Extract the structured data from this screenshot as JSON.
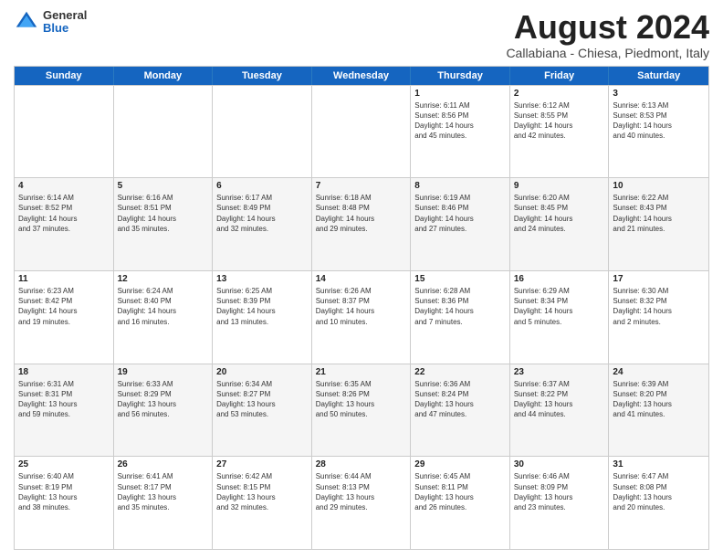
{
  "logo": {
    "general": "General",
    "blue": "Blue"
  },
  "header": {
    "month": "August 2024",
    "location": "Callabiana - Chiesa, Piedmont, Italy"
  },
  "days_of_week": [
    "Sunday",
    "Monday",
    "Tuesday",
    "Wednesday",
    "Thursday",
    "Friday",
    "Saturday"
  ],
  "weeks": [
    [
      {
        "day": "",
        "info": "",
        "empty": true
      },
      {
        "day": "",
        "info": "",
        "empty": true
      },
      {
        "day": "",
        "info": "",
        "empty": true
      },
      {
        "day": "",
        "info": "",
        "empty": true
      },
      {
        "day": "1",
        "info": "Sunrise: 6:11 AM\nSunset: 8:56 PM\nDaylight: 14 hours\nand 45 minutes."
      },
      {
        "day": "2",
        "info": "Sunrise: 6:12 AM\nSunset: 8:55 PM\nDaylight: 14 hours\nand 42 minutes."
      },
      {
        "day": "3",
        "info": "Sunrise: 6:13 AM\nSunset: 8:53 PM\nDaylight: 14 hours\nand 40 minutes."
      }
    ],
    [
      {
        "day": "4",
        "info": "Sunrise: 6:14 AM\nSunset: 8:52 PM\nDaylight: 14 hours\nand 37 minutes."
      },
      {
        "day": "5",
        "info": "Sunrise: 6:16 AM\nSunset: 8:51 PM\nDaylight: 14 hours\nand 35 minutes."
      },
      {
        "day": "6",
        "info": "Sunrise: 6:17 AM\nSunset: 8:49 PM\nDaylight: 14 hours\nand 32 minutes."
      },
      {
        "day": "7",
        "info": "Sunrise: 6:18 AM\nSunset: 8:48 PM\nDaylight: 14 hours\nand 29 minutes."
      },
      {
        "day": "8",
        "info": "Sunrise: 6:19 AM\nSunset: 8:46 PM\nDaylight: 14 hours\nand 27 minutes."
      },
      {
        "day": "9",
        "info": "Sunrise: 6:20 AM\nSunset: 8:45 PM\nDaylight: 14 hours\nand 24 minutes."
      },
      {
        "day": "10",
        "info": "Sunrise: 6:22 AM\nSunset: 8:43 PM\nDaylight: 14 hours\nand 21 minutes."
      }
    ],
    [
      {
        "day": "11",
        "info": "Sunrise: 6:23 AM\nSunset: 8:42 PM\nDaylight: 14 hours\nand 19 minutes."
      },
      {
        "day": "12",
        "info": "Sunrise: 6:24 AM\nSunset: 8:40 PM\nDaylight: 14 hours\nand 16 minutes."
      },
      {
        "day": "13",
        "info": "Sunrise: 6:25 AM\nSunset: 8:39 PM\nDaylight: 14 hours\nand 13 minutes."
      },
      {
        "day": "14",
        "info": "Sunrise: 6:26 AM\nSunset: 8:37 PM\nDaylight: 14 hours\nand 10 minutes."
      },
      {
        "day": "15",
        "info": "Sunrise: 6:28 AM\nSunset: 8:36 PM\nDaylight: 14 hours\nand 7 minutes."
      },
      {
        "day": "16",
        "info": "Sunrise: 6:29 AM\nSunset: 8:34 PM\nDaylight: 14 hours\nand 5 minutes."
      },
      {
        "day": "17",
        "info": "Sunrise: 6:30 AM\nSunset: 8:32 PM\nDaylight: 14 hours\nand 2 minutes."
      }
    ],
    [
      {
        "day": "18",
        "info": "Sunrise: 6:31 AM\nSunset: 8:31 PM\nDaylight: 13 hours\nand 59 minutes."
      },
      {
        "day": "19",
        "info": "Sunrise: 6:33 AM\nSunset: 8:29 PM\nDaylight: 13 hours\nand 56 minutes."
      },
      {
        "day": "20",
        "info": "Sunrise: 6:34 AM\nSunset: 8:27 PM\nDaylight: 13 hours\nand 53 minutes."
      },
      {
        "day": "21",
        "info": "Sunrise: 6:35 AM\nSunset: 8:26 PM\nDaylight: 13 hours\nand 50 minutes."
      },
      {
        "day": "22",
        "info": "Sunrise: 6:36 AM\nSunset: 8:24 PM\nDaylight: 13 hours\nand 47 minutes."
      },
      {
        "day": "23",
        "info": "Sunrise: 6:37 AM\nSunset: 8:22 PM\nDaylight: 13 hours\nand 44 minutes."
      },
      {
        "day": "24",
        "info": "Sunrise: 6:39 AM\nSunset: 8:20 PM\nDaylight: 13 hours\nand 41 minutes."
      }
    ],
    [
      {
        "day": "25",
        "info": "Sunrise: 6:40 AM\nSunset: 8:19 PM\nDaylight: 13 hours\nand 38 minutes."
      },
      {
        "day": "26",
        "info": "Sunrise: 6:41 AM\nSunset: 8:17 PM\nDaylight: 13 hours\nand 35 minutes."
      },
      {
        "day": "27",
        "info": "Sunrise: 6:42 AM\nSunset: 8:15 PM\nDaylight: 13 hours\nand 32 minutes."
      },
      {
        "day": "28",
        "info": "Sunrise: 6:44 AM\nSunset: 8:13 PM\nDaylight: 13 hours\nand 29 minutes."
      },
      {
        "day": "29",
        "info": "Sunrise: 6:45 AM\nSunset: 8:11 PM\nDaylight: 13 hours\nand 26 minutes."
      },
      {
        "day": "30",
        "info": "Sunrise: 6:46 AM\nSunset: 8:09 PM\nDaylight: 13 hours\nand 23 minutes."
      },
      {
        "day": "31",
        "info": "Sunrise: 6:47 AM\nSunset: 8:08 PM\nDaylight: 13 hours\nand 20 minutes."
      }
    ]
  ]
}
